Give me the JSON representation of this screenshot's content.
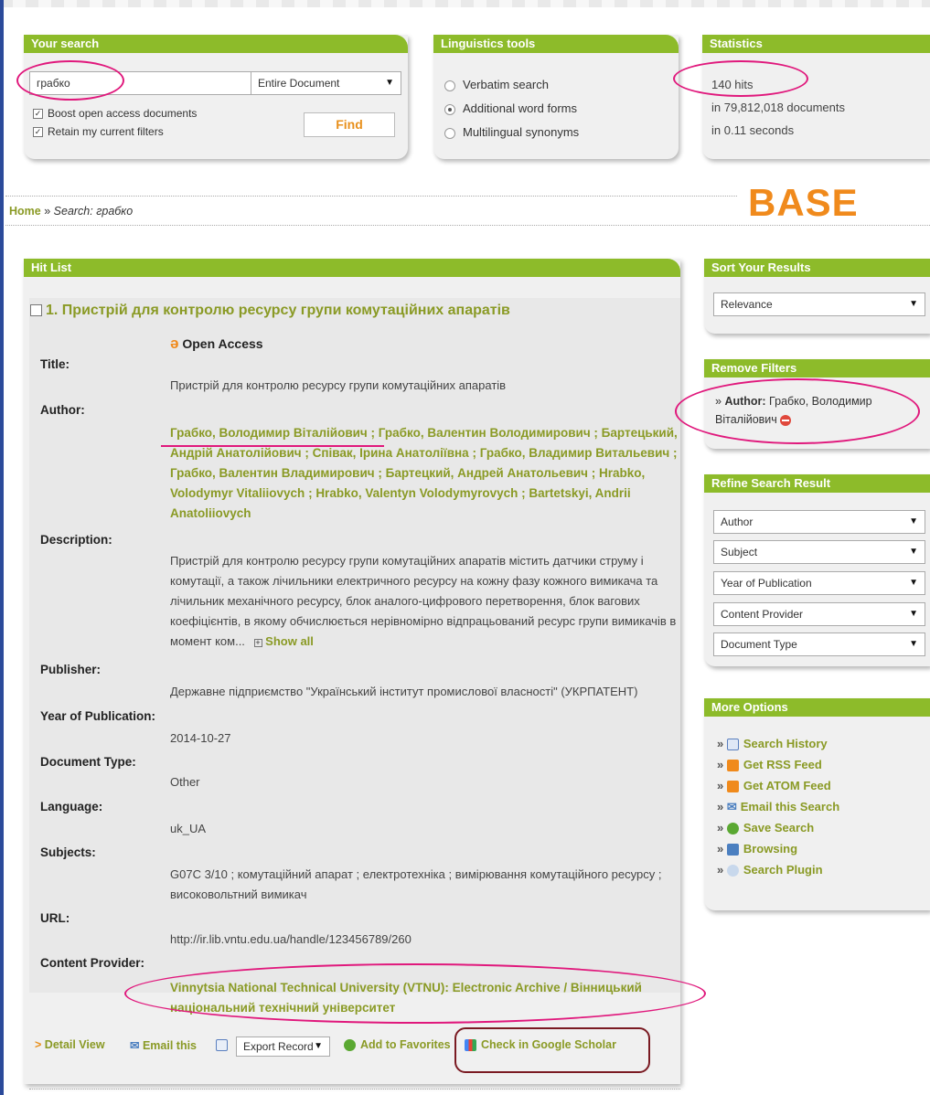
{
  "search": {
    "title": "Your search",
    "query": "грабко",
    "scope": "Entire Document",
    "boost_label": "Boost open access documents",
    "retain_label": "Retain my current filters",
    "find_label": "Find"
  },
  "ling": {
    "title": "Linguistics tools",
    "options": [
      "Verbatim search",
      "Additional word forms",
      "Multilingual synonyms"
    ],
    "selected": "Additional word forms"
  },
  "stats": {
    "title": "Statistics",
    "hits": "140 hits",
    "docs": "in 79,812,018 documents",
    "time": "in 0.11 seconds"
  },
  "breadcrumb": {
    "home": "Home",
    "sep": "»",
    "current": "Search: грабко"
  },
  "logo": "BASE",
  "hitlist": {
    "title": "Hit List",
    "result_title": "1. Пристрій для контролю ресурсу групи комутаційних апаратів",
    "open_access": "Open Access",
    "labels": {
      "title": "Title:",
      "author": "Author:",
      "description": "Description:",
      "publisher": "Publisher:",
      "year": "Year of Publication:",
      "doctype": "Document Type:",
      "language": "Language:",
      "subjects": "Subjects:",
      "url": "URL:",
      "provider": "Content Provider:"
    },
    "title_value": "Пристрій для контролю ресурсу групи комутаційних апаратів",
    "authors": [
      "Грабко, Володимир Віталійович",
      "Грабко, Валентин Володимирович",
      "Бартецький, Андрій Анатолійович",
      "Співак, Ірина Анатоліївна",
      "Грабко, Владимир Витальевич",
      "Грабко, Валентин Владимирович",
      "Бартецкий, Андрей Анатольевич",
      "Hrabko, Volodymyr Vitaliiovych",
      "Hrabko, Valentyn Volodymyrovych",
      "Bartetskyi, Andrii Anatoliiovych"
    ],
    "description": "Пристрій для контролю ресурсу групи комутаційних апаратів містить датчики струму і комутації, а також лічильники електричного ресурсу на кожну фазу кожного вимикача та лічильник механічного ресурсу, блок аналого-цифрового перетворення, блок вагових коефіцієнтів, в якому обчислюється нерівномірно відпрацьований ресурс групи вимикачів в момент ком...",
    "show_all": "Show all",
    "publisher": "Державне підприємство \"Український інститут промислової власності\" (УКРПАТЕНТ)",
    "year": "2014-10-27",
    "doctype": "Other",
    "language": "uk_UA",
    "subjects": "G07C 3/10 ; комутаційний апарат ; електротехніка ; вимірювання комутаційного ресурсу ; високовольтний вимикач",
    "url": "http://ir.lib.vntu.edu.ua/handle/123456789/260",
    "provider": "Vinnytsia National Technical University (VTNU): Electronic Archive / Вінницький національний технічний університет"
  },
  "actions": {
    "detail": "Detail View",
    "email": "Email this",
    "export": "Export Record",
    "favorites": "Add to Favorites",
    "scholar": "Check in Google Scholar"
  },
  "sort": {
    "title": "Sort Your Results",
    "value": "Relevance"
  },
  "filters": {
    "title": "Remove Filters",
    "label": "Author:",
    "value": "Грабко, Володимир Віталійович"
  },
  "refine": {
    "title": "Refine Search Result",
    "items": [
      "Author",
      "Subject",
      "Year of Publication",
      "Content Provider",
      "Document Type"
    ]
  },
  "more": {
    "title": "More Options",
    "items": [
      "Search History",
      "Get RSS Feed",
      "Get ATOM Feed",
      "Email this Search",
      "Save Search",
      "Browsing",
      "Search Plugin"
    ]
  },
  "colors": {
    "accent": "#8dbb2a",
    "link": "#8a9a25",
    "logo": "#f08a1c",
    "highlight": "#e0187c",
    "scholar_box": "#7a1a22"
  }
}
